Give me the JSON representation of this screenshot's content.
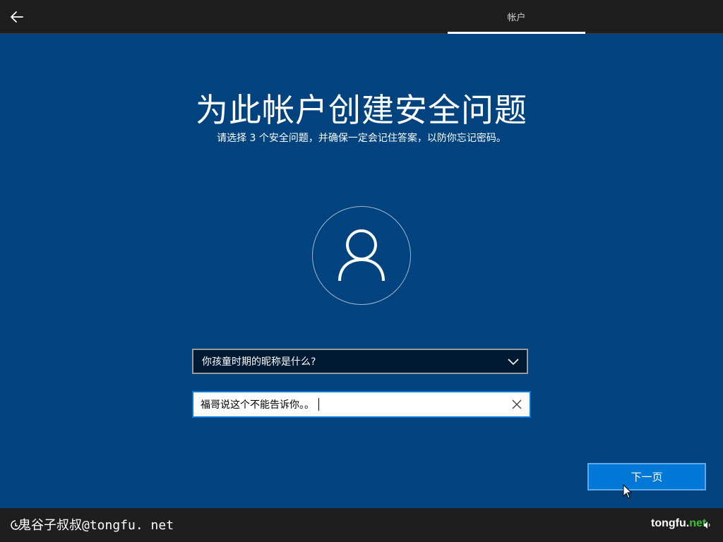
{
  "header": {
    "back_icon": "back-arrow-icon",
    "tab_label": "帐户"
  },
  "main": {
    "title": "为此帐户创建安全问题",
    "subtitle": "请选择 3 个安全问题，并确保一定会记住答案，以防你忘记密码。",
    "avatar_icon": "user-icon",
    "question": {
      "selected": "你孩童时期的昵称是什么?",
      "icon": "chevron-down-icon"
    },
    "answer": {
      "value": "福哥说这个不能告诉你。。",
      "clear_icon": "close-icon"
    },
    "next_label": "下一页"
  },
  "footer": {
    "watermark_left": "鬼谷子叔叔@tongfu. net",
    "watermark_right_main": "tongfu.",
    "watermark_right_accent": "net",
    "accessibility_icon": "accessibility-icon",
    "sound_icon": "sound-icon"
  },
  "colors": {
    "background": "#00437e",
    "accent": "#0078d7",
    "bar": "#1e1e1e"
  }
}
